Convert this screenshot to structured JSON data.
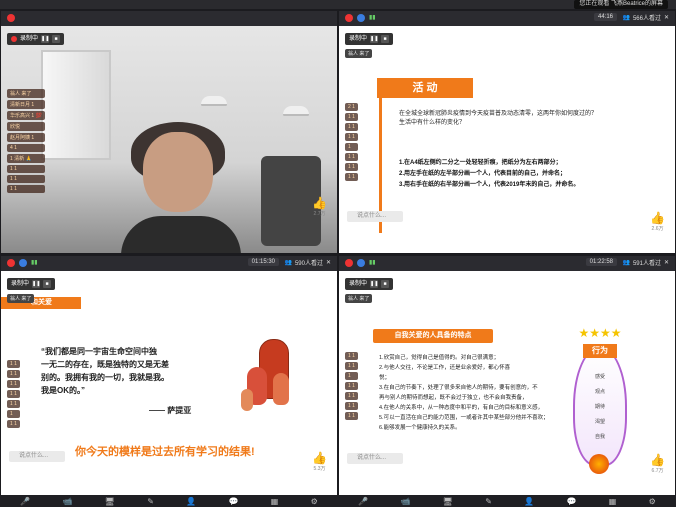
{
  "top_tip": "您正在观看 飞燕Beatrice的屏幕",
  "panels": [
    {
      "rec_label": "录制中",
      "sub_tag": "",
      "comments": [
        "1",
        "翁人 来了",
        "清新日月 1",
        "华乐高兴 1 💯",
        "欣悦 ",
        "赵月阿姨 1",
        "4 1",
        "1 清新 🙏",
        "1 1",
        "1 1",
        "1 1",
        "1 1 1"
      ],
      "input_placeholder": "说点什么...",
      "like_count": "2.7万"
    },
    {
      "timer": "44:16",
      "views": "566人看过",
      "rec_label": "录制中",
      "sub_tag": "翁人 来了",
      "activity_title": "活 动",
      "q1": "在全城全球新冠肺炎疫情到今天疫苗普及动态清零，这两年你如何度过的？",
      "q2": "生活中有什么样的变化？",
      "step1": "1.在A4纸左侧约二分之一处轻轻折痕，把纸分为左右两部分；",
      "step2": "2.用左手在纸的左半部分画一个人，代表目前的自己，并命名；",
      "step3": "3.用右手在纸的右半部分画一个人，代表2019年末的自己，并命名。",
      "comments": [
        "2 1",
        "1 1",
        "1 1",
        "1 1",
        "1",
        "1 1",
        "1 1",
        "1 1"
      ],
      "input_placeholder": "说点什么...",
      "like_count": "2.6万"
    },
    {
      "timer": "01:15:30",
      "views": "590人看过",
      "rec_label": "录制中",
      "sub_tag": "翁人 来了",
      "header_text": "和关爱",
      "quote_l1": "“我们都是同一宇宙生命空间中独",
      "quote_l2": "一无二的存在，既是独特的又是无差",
      "quote_l3": "别的。我拥有我的一切，我就是我。",
      "quote_l4": "我是OK的。”",
      "quote_author": "—— 萨提亚",
      "footer_text": "你今天的模样是过去所有学习的结果!",
      "comments": [
        "1 1",
        "1 1",
        "1 1",
        "1 1",
        "1 1",
        "1",
        "1 1"
      ],
      "input_placeholder": "说点什么...",
      "like_count": "5.3万"
    },
    {
      "timer": "01:22:58",
      "views": "591人看过",
      "rec_label": "录制中",
      "sub_tag": "翁人 来了",
      "slide_title": "自我关爱的人具备的特点",
      "traits": [
        "1.欣赏自己，觉得自己是值得的。对自己很满意；",
        "2.与他人交往，不论是工作，还是业余爱好，都心怀喜",
        "悦；",
        "3.在自己的节奏下，处理了很多来自他人的期待，要有创意的，不",
        "再与别人的期待而想起，既不会过于独立，也不会自我责备，",
        "4.在他人的关系中，从一种态度中和平的，有自己的目标和意义感，",
        "5.可以一直活在自己的能力范围，一或者许其中某些部分他并不喜欢；",
        "6.能够发展一个健康持久的关系。"
      ],
      "diagram_top": "行为",
      "diagram_labels": [
        "感受",
        "观点",
        "期待",
        "渴望",
        "自我"
      ],
      "comments": [
        "1 1",
        "1 1",
        "1",
        "1 1",
        "1 1",
        "1 1",
        "1 1"
      ],
      "input_placeholder": "说点什么...",
      "like_count": "6.7万"
    }
  ],
  "colors": {
    "accent": "#f07a1a",
    "dark": "#2b2b30",
    "red": "#d03a1a"
  }
}
